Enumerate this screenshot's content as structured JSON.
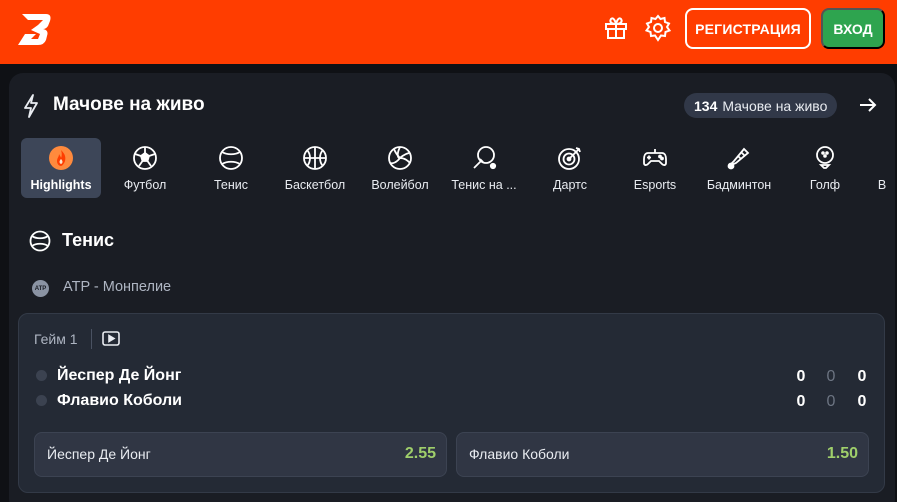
{
  "header": {
    "register_label": "РЕГИСТРАЦИЯ",
    "login_label": "ВХОД",
    "brand_color": "#ff3d00",
    "login_color": "#2ea44f"
  },
  "live": {
    "title": "Мачове на живо",
    "count": "134",
    "count_label": "Мачове на живо"
  },
  "sports": [
    {
      "label": "Highlights",
      "icon": "flame-icon",
      "active": true
    },
    {
      "label": "Футбол",
      "icon": "soccer-ball-icon"
    },
    {
      "label": "Тенис",
      "icon": "tennis-ball-icon"
    },
    {
      "label": "Баскетбол",
      "icon": "basketball-icon"
    },
    {
      "label": "Волейбол",
      "icon": "volleyball-icon"
    },
    {
      "label": "Тенис на ...",
      "icon": "table-tennis-icon"
    },
    {
      "label": "Дартс",
      "icon": "darts-icon"
    },
    {
      "label": "Esports",
      "icon": "gamepad-icon"
    },
    {
      "label": "Бадминтон",
      "icon": "shuttlecock-icon"
    },
    {
      "label": "Голф",
      "icon": "golf-icon"
    },
    {
      "label": "В",
      "icon": "more-sport-icon"
    }
  ],
  "section": {
    "title": "Тенис",
    "tournament_badge": "ATP",
    "tournament": "ATP - Монпелие"
  },
  "match": {
    "game_label": "Гейм 1",
    "players": [
      {
        "name": "Йеспер Де Йонг",
        "scores": [
          "0",
          "0",
          "0"
        ]
      },
      {
        "name": "Флавио Коболи",
        "scores": [
          "0",
          "0",
          "0"
        ]
      }
    ],
    "odds": [
      {
        "name": "Йеспер Де Йонг",
        "value": "2.55"
      },
      {
        "name": "Флавио Коболи",
        "value": "1.50"
      }
    ]
  }
}
